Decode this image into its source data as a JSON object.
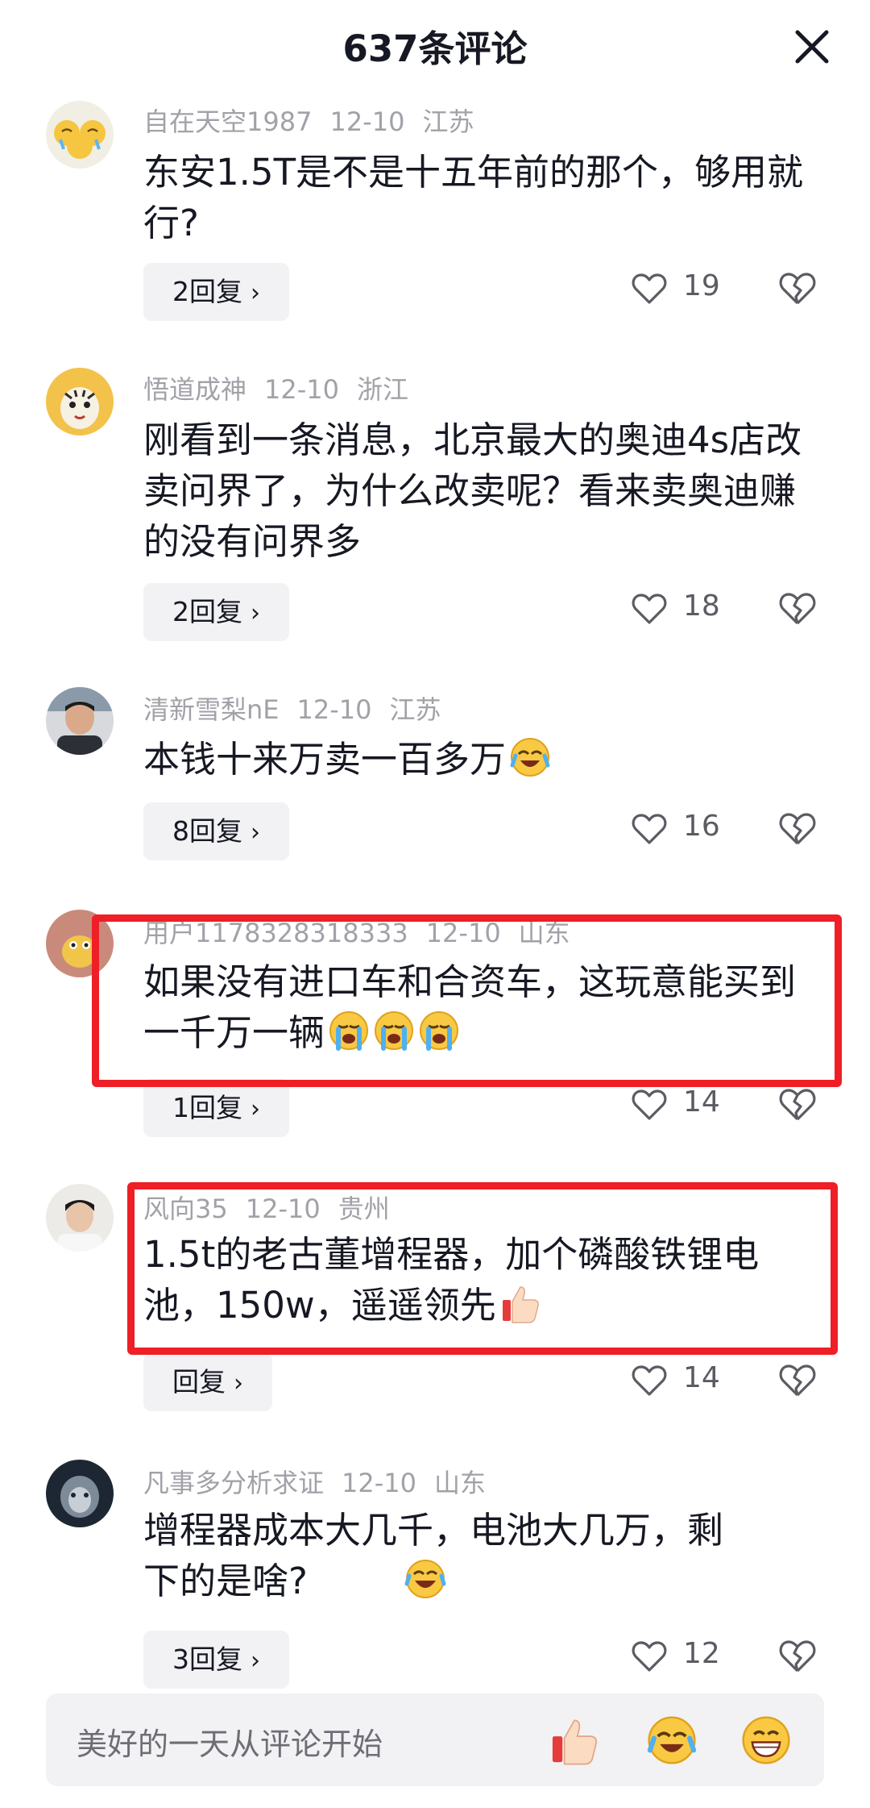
{
  "header": {
    "title": "637条评论"
  },
  "comments": [
    {
      "username": "自在天空1987",
      "date": "12-10",
      "location": "江苏",
      "text": "东安1.5T是不是十五年前的那个，够用就行?",
      "reply": "2回复",
      "likes": "19"
    },
    {
      "username": "悟道成神",
      "date": "12-10",
      "location": "浙江",
      "text": "刚看到一条消息，北京最大的奥迪4s店改卖问界了，为什么改卖呢？看来卖奥迪赚的没有问界多",
      "reply": "2回复",
      "likes": "18"
    },
    {
      "username": "清新雪梨nE",
      "date": "12-10",
      "location": "江苏",
      "text": "本钱十来万卖一百多万",
      "reply": "8回复",
      "likes": "16"
    },
    {
      "username": "用户1178328318333",
      "date": "12-10",
      "location": "山东",
      "text": "如果没有进口车和合资车，这玩意能买到一千万一辆",
      "reply": "1回复",
      "likes": "14"
    },
    {
      "username": "风向35",
      "date": "12-10",
      "location": "贵州",
      "text": "1.5t的老古董增程器，加个磷酸铁锂电池，150w，遥遥领先",
      "reply": "回复",
      "likes": "14"
    },
    {
      "username": "凡事多分析求证",
      "date": "12-10",
      "location": "山东",
      "text": "增程器成本大几千，电池大几万，剩下的是啥?",
      "reply": "3回复",
      "likes": "12"
    }
  ],
  "input": {
    "placeholder": "美好的一天从评论开始"
  },
  "icons": {
    "close": "close-icon",
    "like": "heart-outline-icon",
    "dislike": "broken-heart-icon",
    "emoji_cry_laugh": "crying-laughing-emoji",
    "emoji_sob": "sobbing-emoji",
    "emoji_thumbs": "thumbs-up-emoji",
    "emoji_laugh": "laughing-emoji",
    "emoji_grin": "grinning-emoji"
  },
  "colors": {
    "highlight": "#ee1f26",
    "meta": "#a1a2a8",
    "text": "#161823",
    "button_bg": "#f2f2f4"
  }
}
